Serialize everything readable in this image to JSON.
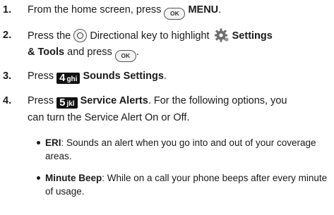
{
  "steps": [
    {
      "num": "1.",
      "text_a": "From the home screen, press",
      "key": "OK",
      "bold": "MENU",
      "text_b": "."
    },
    {
      "num": "2.",
      "text_a": "Press the",
      "text_b": "Directional key to highlight",
      "bold_a": "Settings",
      "bold_b": "& Tools",
      "text_c": "and press",
      "key": "OK",
      "text_d": "."
    },
    {
      "num": "3.",
      "text_a": "Press",
      "key_digit": "4",
      "key_letters": "ghi",
      "bold": "Sounds Settings",
      "text_b": "."
    },
    {
      "num": "4.",
      "text_a": "Press",
      "key_digit": "5",
      "key_letters": "jkl",
      "bold": "Service Alerts",
      "text_b": ". For the following options, you",
      "text_c": "can turn the Service Alert On or Off."
    }
  ],
  "bullets": [
    {
      "term": "ERI",
      "line1": ": Sounds an alert when you go into and out of your coverage",
      "line2": "areas."
    },
    {
      "term": "Minute Beep",
      "line1": ": While on a call your phone beeps after every minute",
      "line2": "of usage."
    }
  ],
  "icons": {
    "ok_key": "ok-key-icon",
    "directional_key": "directional-key-icon",
    "settings": "settings-gear-icon"
  }
}
